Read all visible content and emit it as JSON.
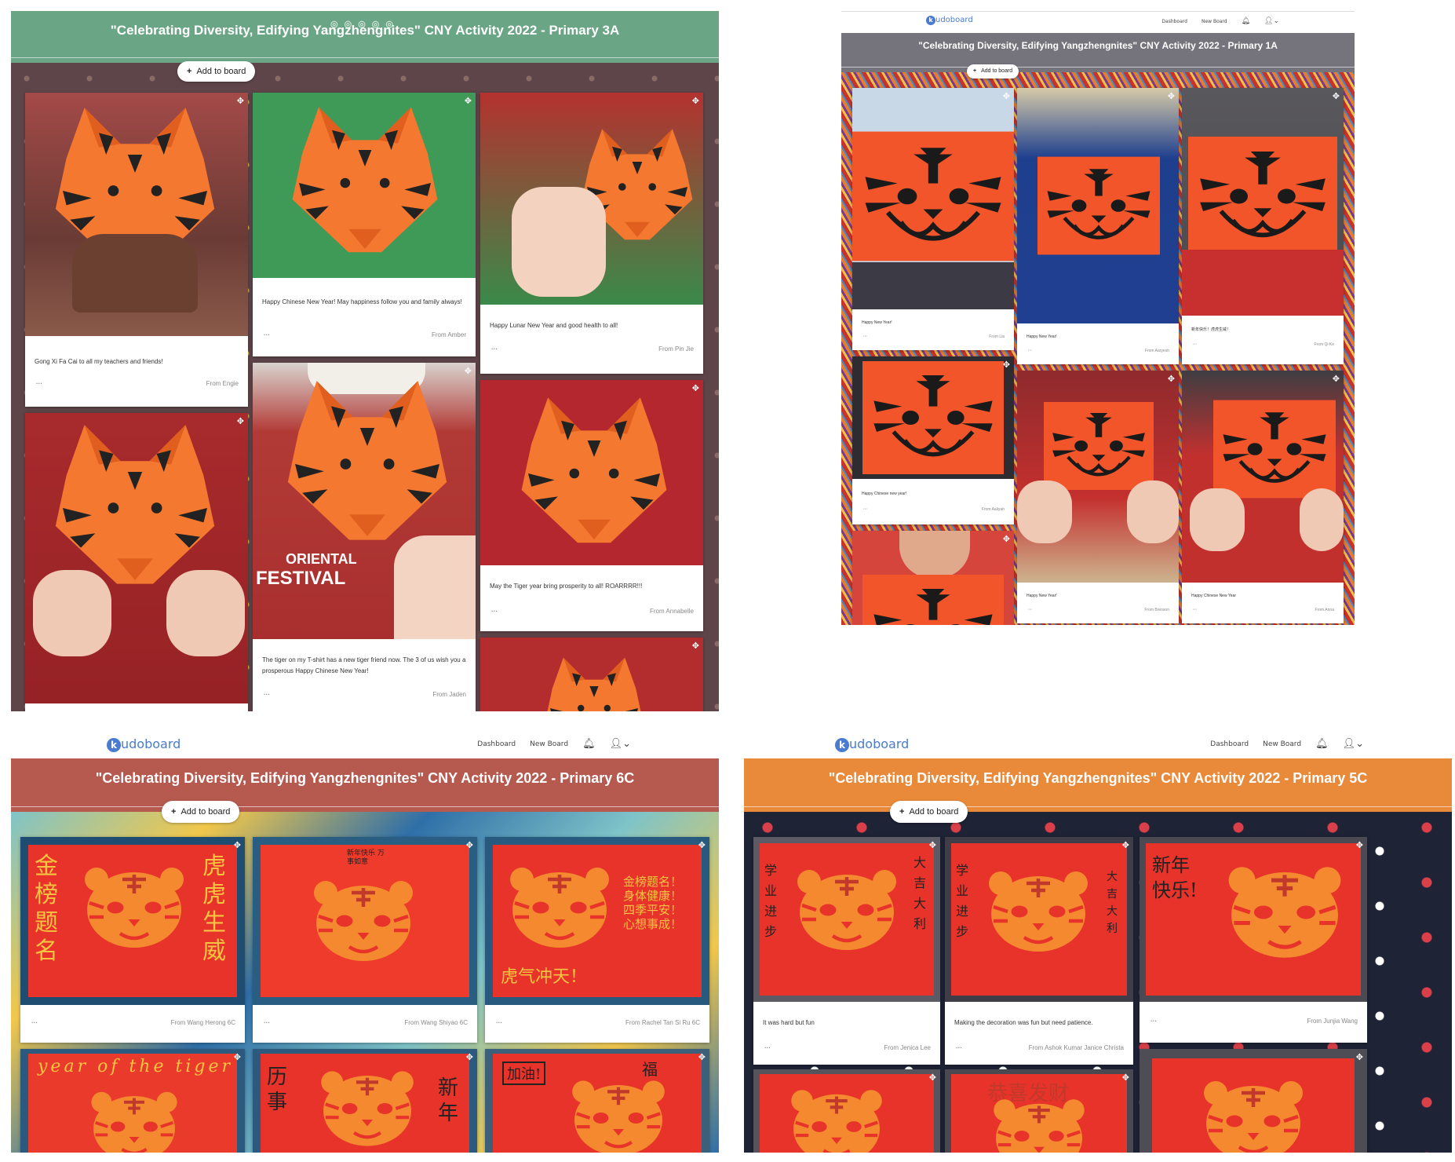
{
  "colors": {
    "green_bar": "#6aa686",
    "gray_bar": "#75737b",
    "red_bar": "#b65a50",
    "orange_bar": "#e98a3a",
    "tiger_orange": "#f4782f",
    "paper_red": "#e8332a",
    "logo_blue": "#4a7bd0"
  },
  "p3a": {
    "title": "\"Celebrating Diversity, Edifying Yangzhengnites\" CNY  Activity 2022 - Primary 3A",
    "add": "Add to board",
    "posts": [
      {
        "msg": "Gong Xi Fa Cai to all my teachers and friends!",
        "from": "From Engie"
      },
      {
        "msg": "Happy Chinese New Year! May happiness follow you and family always!",
        "from": "From Amber"
      },
      {
        "msg": "Happy Lunar New Year and good health to all!",
        "from": "From Pin Jie"
      },
      {
        "msg": "",
        "from": ""
      },
      {
        "msg": "The tiger on my T-shirt has a new tiger friend now. The 3 of us wish you a prosperous Happy Chinese New Year!",
        "from": "From Jaden",
        "shirt1": "ORIENTAL",
        "shirt2": "FESTIVAL"
      },
      {
        "msg": "May the Tiger year bring prosperity to all! ROARRRR!!!",
        "from": "From Annabelle"
      },
      {
        "msg": "",
        "from": ""
      }
    ]
  },
  "p1a": {
    "logo": "udoboard",
    "nav": {
      "dashboard": "Dashboard",
      "new_board": "New Board"
    },
    "title": "\"Celebrating Diversity, Edifying Yangzhengnites\" CNY  Activity 2022 - Primary 1A",
    "add": "Add to board",
    "posts": [
      {
        "msg": "Happy New Year!",
        "from": "From Lia"
      },
      {
        "msg": "Happy New Year!",
        "from": "From Aaryesh"
      },
      {
        "msg": "新年快乐！虎虎生威！",
        "from": "From Qi Ke"
      },
      {
        "msg": "Happy Chinese new year!",
        "from": "From Aaliyah"
      },
      {
        "msg": "Happy New Year!",
        "from": "From Brenson"
      },
      {
        "msg": "Happy Chinese New Year",
        "from": "From Anna"
      },
      {
        "msg": "",
        "from": ""
      }
    ]
  },
  "p6c": {
    "logo": "udoboard",
    "nav": {
      "dashboard": "Dashboard",
      "new_board": "New Board"
    },
    "title": "\"Celebrating Diversity, Edifying Yangzhengnites\" CNY  Activity 2022 - Primary 6C",
    "add": "Add to board",
    "posts": [
      {
        "from": "From Wang Herong 6C",
        "t1": "金榜题名",
        "t2": "虎虎生威"
      },
      {
        "from": "From Wang Shiyao 6C",
        "t1": "新年快乐 万事如意",
        "t2": ""
      },
      {
        "from": "From Rachel Tan Si Ru 6C",
        "t1": "金榜题名！身体健康！四季平安！心想事成！",
        "t2": "虎气冲天！"
      },
      {
        "from": "",
        "t1": "year of the tiger",
        "t2": ""
      },
      {
        "from": "",
        "t1": "历事",
        "t2": "新年"
      },
      {
        "from": "",
        "t1": "加油!",
        "t2": "福"
      }
    ]
  },
  "p5c": {
    "logo": "udoboard",
    "nav": {
      "dashboard": "Dashboard",
      "new_board": "New Board"
    },
    "title": "\"Celebrating Diversity, Edifying Yangzhengnites\" CNY  Activity 2022 - Primary 5C",
    "add": "Add to board",
    "posts": [
      {
        "msg": "It was hard but fun",
        "from": "From Jenica Lee",
        "t1": "学业进步",
        "t2": "大吉大利"
      },
      {
        "msg": "Making the decoration was fun but need patience.",
        "from": "From Ashok Kumar Janice Christa",
        "t1": "学业进步",
        "t2": "大吉大利"
      },
      {
        "msg": "",
        "from": "From Junjia Wang",
        "t1": "新年快乐!",
        "t2": ""
      },
      {
        "msg": "",
        "from": "",
        "t1": "",
        "t2": ""
      },
      {
        "msg": "",
        "from": "",
        "t1": "恭喜发财",
        "t2": ""
      },
      {
        "msg": "",
        "from": "",
        "t1": "",
        "t2": ""
      }
    ]
  }
}
